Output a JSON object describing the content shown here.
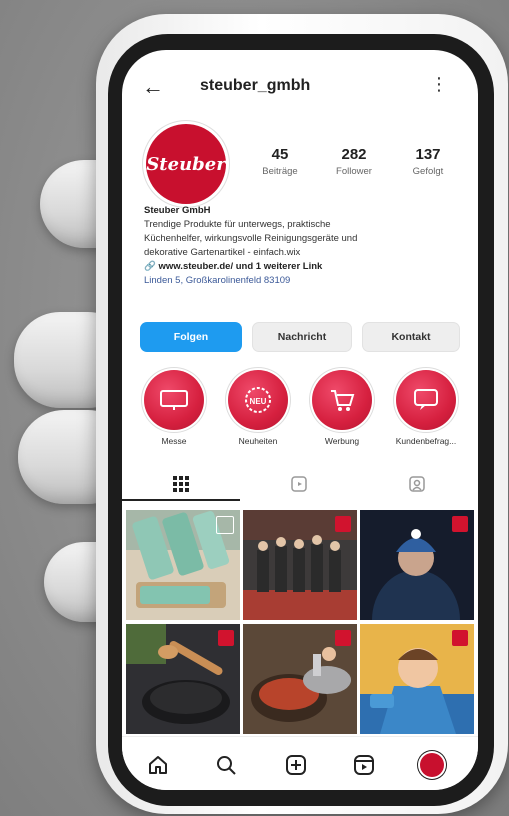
{
  "profile": {
    "username": "steuber_gmbh",
    "avatar_text": "Steuber",
    "stats": [
      {
        "value": "45",
        "label": "Beiträge"
      },
      {
        "value": "282",
        "label": "Follower"
      },
      {
        "value": "137",
        "label": "Gefolgt"
      }
    ],
    "bio": {
      "name": "Steuber GmbH",
      "line1": "Trendige Produkte für unterwegs, praktische",
      "line2": "Küchenhelfer, wirkungsvolle Reinigungsgeräte und",
      "line3": "dekorative Gartenartikel - einfach.wix",
      "link": "www.steuber.de/ und 1 weiterer Link",
      "location": "Linden 5, Großkarolinenfeld 83109"
    }
  },
  "actions": {
    "follow": "Folgen",
    "message": "Nachricht",
    "contact": "Kontakt"
  },
  "highlights": [
    {
      "label": "Messe",
      "icon": "display-icon"
    },
    {
      "label": "Neuheiten",
      "icon": "new-badge-icon"
    },
    {
      "label": "Werbung",
      "icon": "shopping-cart-icon"
    },
    {
      "label": "Kundenbefrag...",
      "icon": "chat-bubble-icon"
    }
  ],
  "tabs": [
    "grid-icon",
    "reels-icon",
    "tagged-icon"
  ],
  "nav": [
    "home-icon",
    "search-icon",
    "add-icon",
    "reels-icon",
    "profile-avatar"
  ],
  "colors": {
    "brand_red": "#c8102e",
    "follow_blue": "#1e9bf0"
  }
}
